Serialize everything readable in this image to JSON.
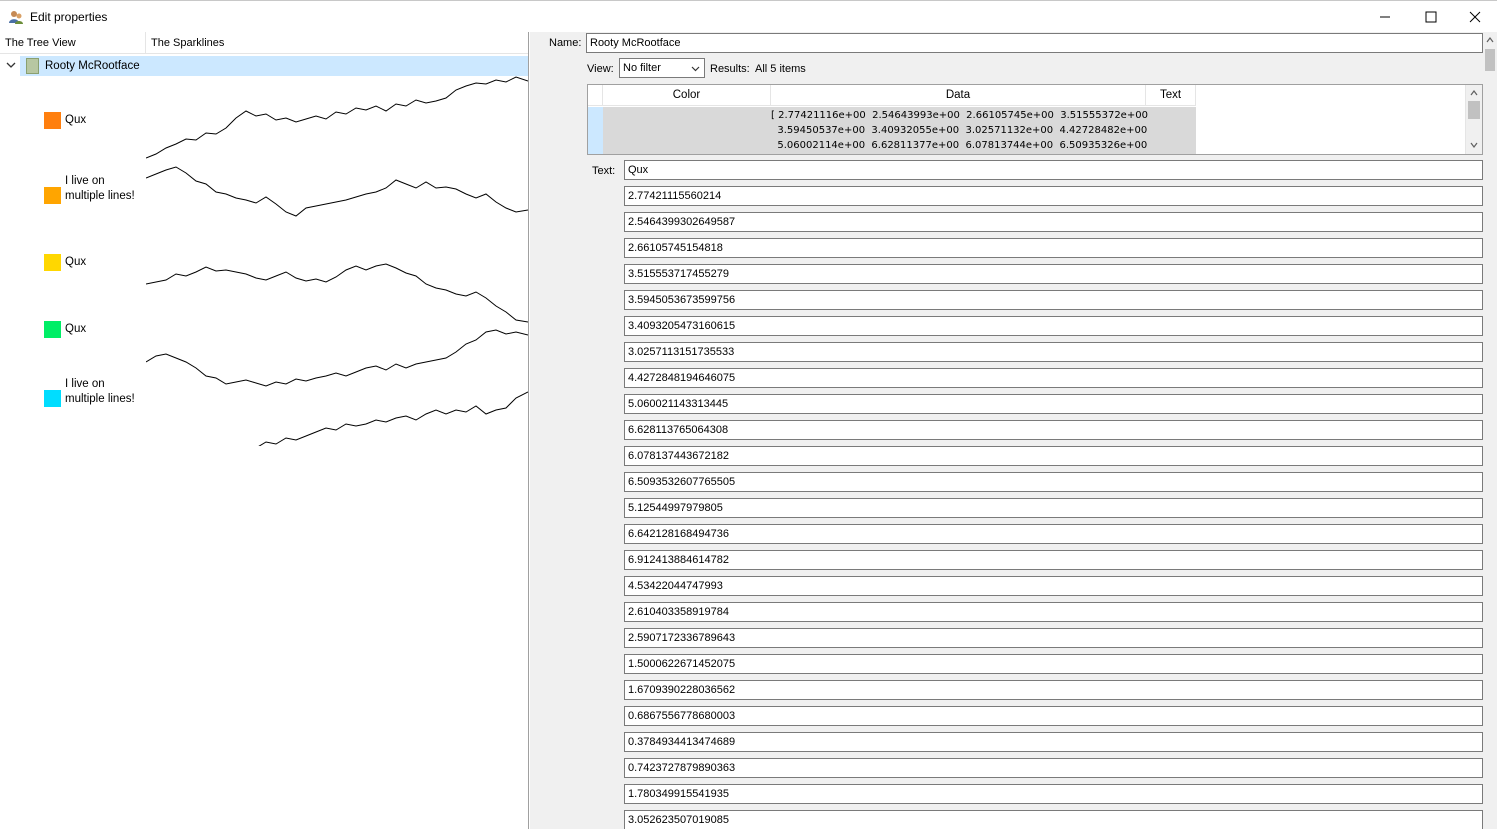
{
  "window": {
    "title": "Edit properties"
  },
  "tree": {
    "headers": [
      "The Tree View",
      "The Sparklines"
    ],
    "root": {
      "label": "Rooty McRootface"
    },
    "children": [
      {
        "label": "Qux",
        "color": "#ff7f0e"
      },
      {
        "label": "I live on multiple lines!",
        "color": "#ffa500"
      },
      {
        "label": "Qux",
        "color": "#ffd700"
      },
      {
        "label": "Qux",
        "color": "#00ee66"
      },
      {
        "label": "I live on multiple lines!",
        "color": "#00ddff"
      }
    ]
  },
  "editor": {
    "name_label": "Name:",
    "name_value": "Rooty McRootface",
    "view_label": "View:",
    "view_value": "No filter",
    "results_label": "Results:",
    "results_value": "All 5 items",
    "grid_headers": [
      "Color",
      "Data",
      "Text"
    ],
    "grid_data_text": "[ 2.77421116e+00  2.54643993e+00  2.66105745e+00  3.51555372e+00\n  3.59450537e+00  3.40932055e+00  3.02571132e+00  4.42728482e+00\n  5.06002114e+00  6.62811377e+00  6.07813744e+00  6.50935326e+00",
    "text_label": "Text:",
    "text_value": "Qux",
    "values": [
      "2.77421115560214",
      "2.5464399302649587",
      "2.66105745154818",
      "3.515553717455279",
      "3.5945053673599756",
      "3.4093205473160615",
      "3.0257113151735533",
      "4.4272848194646075",
      "5.060021143313445",
      "6.628113765064308",
      "6.078137443672182",
      "6.5093532607765505",
      "5.12544997979805",
      "6.642128168494736",
      "6.912413884614782",
      "4.53422044747993",
      "2.610403358919784",
      "2.5907172336789643",
      "1.5000622671452075",
      "1.6709390228036562",
      "0.6867556778680003",
      "0.3784934413474689",
      "0.7423727879890363",
      "1.780349915541935",
      "3.052623507019085"
    ]
  }
}
